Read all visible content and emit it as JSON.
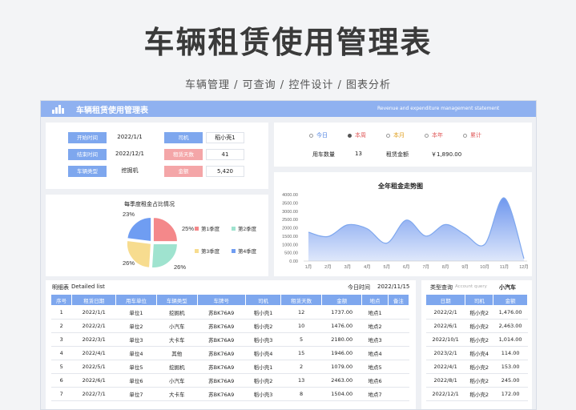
{
  "hero": {
    "title": "车辆租赁使用管理表",
    "subtitle": "车辆管理 / 可查询 / 控件设计 / 图表分析"
  },
  "sheet": {
    "title": "车辆租赁使用管理表",
    "subtitle_en": "Revenue and expenditure management statement"
  },
  "filters": {
    "start_label": "开始时间",
    "start_value": "2022/1/1",
    "end_label": "结束时间",
    "end_value": "2022/12/1",
    "type_label": "车辆类型",
    "type_value": "挖掘机",
    "driver_label": "司机",
    "driver_value": "稻小壳1",
    "days_label": "租赁天数",
    "days_value": "41",
    "amount_label": "金额",
    "amount_value": "5,420"
  },
  "period": {
    "options": [
      "今日",
      "本周",
      "本月",
      "本年",
      "累计"
    ],
    "option_colors": [
      "#4a7fe0",
      "#e05a5a",
      "#e0a020",
      "#e05a5a",
      "#e05a5a"
    ],
    "selected_index": 1,
    "usage_label": "用车数量",
    "usage_value": "13",
    "rent_label": "租赁金额",
    "rent_value": "￥1,890.00"
  },
  "pie": {
    "title": "每季度租金占比情况",
    "legend": [
      "第1季度",
      "第2季度",
      "第3季度",
      "第4季度"
    ]
  },
  "detail": {
    "title": "明细表",
    "title_en": "Detailed list",
    "query_label": "今日时间",
    "query_date": "2022/11/15",
    "columns": [
      "序号",
      "租赁日期",
      "用车单位",
      "车辆类型",
      "车牌号",
      "司机",
      "租赁天数",
      "金额",
      "地点",
      "备注"
    ],
    "rows": [
      [
        "1",
        "2022/1/1",
        "单位1",
        "挖掘机",
        "苏BK76A9",
        "稻小壳1",
        "12",
        "1737.00",
        "地点1",
        ""
      ],
      [
        "2",
        "2022/2/1",
        "单位2",
        "小汽车",
        "苏BK76A9",
        "稻小壳2",
        "10",
        "1476.00",
        "地点2",
        ""
      ],
      [
        "3",
        "2022/3/1",
        "单位3",
        "大卡车",
        "苏BK76A9",
        "稻小壳3",
        "5",
        "2180.00",
        "地点3",
        ""
      ],
      [
        "4",
        "2022/4/1",
        "单位4",
        "其他",
        "苏BK76A9",
        "稻小壳4",
        "15",
        "1946.00",
        "地点4",
        ""
      ],
      [
        "5",
        "2022/5/1",
        "单位5",
        "挖掘机",
        "苏BK76A9",
        "稻小壳1",
        "2",
        "1079.00",
        "地点5",
        ""
      ],
      [
        "6",
        "2022/6/1",
        "单位6",
        "小汽车",
        "苏BK76A9",
        "稻小壳2",
        "13",
        "2463.00",
        "地点6",
        ""
      ],
      [
        "7",
        "2022/7/1",
        "单位7",
        "大卡车",
        "苏BK76A9",
        "稻小壳3",
        "8",
        "1504.00",
        "地点7",
        ""
      ]
    ]
  },
  "query": {
    "label": "类型查询",
    "placeholder": "Account query",
    "value": "小汽车",
    "columns": [
      "日期",
      "司机",
      "金额"
    ],
    "rows": [
      [
        "2022/2/1",
        "稻小壳2",
        "1,476.00"
      ],
      [
        "2022/6/1",
        "稻小壳2",
        "2,463.00"
      ],
      [
        "2022/10/1",
        "稻小壳2",
        "1,014.00"
      ],
      [
        "2023/2/1",
        "稻小壳4",
        "114.00"
      ],
      [
        "2022/4/1",
        "稻小壳2",
        "153.00"
      ],
      [
        "2022/8/1",
        "稻小壳2",
        "245.00"
      ],
      [
        "2022/12/1",
        "稻小壳2",
        "172.00"
      ]
    ]
  },
  "chart_data": [
    {
      "type": "pie",
      "title": "每季度租金占比情况",
      "labels": [
        "第1季度",
        "第2季度",
        "第3季度",
        "第4季度"
      ],
      "values": [
        25,
        26,
        26,
        23
      ],
      "value_labels": [
        "25%",
        "26%",
        "26%",
        "23%"
      ],
      "colors": [
        "#f4888a",
        "#9fe3cf",
        "#f7dc8f",
        "#6f9df2"
      ]
    },
    {
      "type": "area",
      "title": "全年租金走势图",
      "categories": [
        "1月",
        "2月",
        "3月",
        "4月",
        "5月",
        "6月",
        "7月",
        "8月",
        "9月",
        "10月",
        "11月",
        "12月"
      ],
      "series": [
        {
          "values": [
            1737,
            1476,
            2180,
            1946,
            1079,
            2463,
            1504,
            2200,
            1600,
            1010,
            3800,
            150
          ]
        }
      ],
      "ylim": [
        0,
        4000
      ],
      "yticks": [
        "0.00",
        "500.00",
        "1000.00",
        "1500.00",
        "2000.00",
        "2500.00",
        "3000.00",
        "3500.00",
        "4000.00"
      ],
      "color": "#7ea7ee"
    }
  ]
}
